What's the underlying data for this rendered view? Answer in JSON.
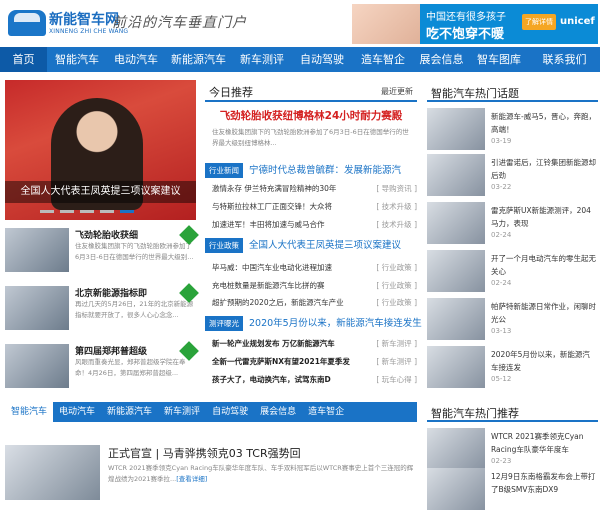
{
  "header": {
    "logo_text": "新能智车网",
    "logo_sub": "XINNENG ZHI CHE WANG",
    "slogan": "前沿的汽车垂直门户",
    "ad": {
      "line1": "中国还有很多孩子",
      "line2": "吃不饱穿不暖",
      "button": "了解详情",
      "brand": "unicef"
    }
  },
  "nav": {
    "items": [
      "首页",
      "智能汽车",
      "电动汽车",
      "新能源汽车",
      "新车测评",
      "自动驾驶",
      "造车智企",
      "展会信息",
      "智车图库",
      "联系我们"
    ]
  },
  "slider": {
    "caption": "全国人大代表王凤英提三项议案建议",
    "dots": 5,
    "active_dot": 5
  },
  "left_list": [
    {
      "title": "飞劲轮胎收获细",
      "desc": "住友橡胶集团旗下的飞劲轮胎欧洲参加了6月3日-6日在德国举行的世界最大级别..."
    },
    {
      "title": "北京新能源指标即",
      "desc": "再过几天的5月26日，21年的北京新能源指标就要开放了，很多人心心念念..."
    },
    {
      "title": "第四届郑邦普超级",
      "desc": "风眼而重奏光显，郑邦普超级学院在奉命！4月26日，第四届郑邦普超级..."
    }
  ],
  "middle": {
    "head_title": "今日推荐",
    "head_right": "最近更新",
    "headline": "飞劲轮胎收获纽博格林24小时耐力赛殿",
    "headline_desc": "住友橡胶集团旗下的飞劲轮胎欧洲参加了6月3日-6日在德国举行的世界最大级别纽博格林...",
    "sections": [
      {
        "label": "行业新闻",
        "title": "宁德时代总裁曾毓群：发展新能源汽",
        "rows": [
          {
            "text": "激情永存 伊兰特充满冒险精神的30年",
            "cat": "[ 导购资讯 ]"
          },
          {
            "text": "与特斯拉拉林工厂正面交锋！大众将",
            "cat": "[ 技术升级 ]"
          },
          {
            "text": "加速进军！丰田将加速与威马合作",
            "cat": "[ 技术升级 ]"
          }
        ]
      },
      {
        "label": "行业政策",
        "title": "全国人大代表王凤英提三项议案建议",
        "rows": [
          {
            "text": "毕马威：中国汽车业电动化进程加速",
            "cat": "[ 行业政策 ]"
          },
          {
            "text": "充电桩数量是新能源汽车比拼的赛",
            "cat": "[ 行业政策 ]"
          },
          {
            "text": "超扩预期的2020之后，新能源汽车产业",
            "cat": "[ 行业政策 ]"
          }
        ]
      },
      {
        "label": "测评曝光",
        "title": "2020年5月份以来，新能源汽车接连发生",
        "rows": [
          {
            "text": "新一轮产业规划发布 万亿新能源汽车",
            "cat": "[ 新车测评 ]"
          },
          {
            "text": "全新一代雷克萨斯NX有望2021年夏季发",
            "cat": "[ 新车测评 ]"
          },
          {
            "text": "孩子大了，电动换汽车，试驾东南D",
            "cat": "[ 玩车心得 ]"
          }
        ]
      }
    ]
  },
  "right_top": {
    "title": "智能汽车热门话题",
    "items": [
      {
        "text": "新能源车-威马5，晋心，奔跑，高端！",
        "date": "03-19"
      },
      {
        "text": "引进雷诺后，江铃集团新能源却后劲",
        "date": "03-22"
      },
      {
        "text": "雷克萨斯UX新能源测评，204马力，表现",
        "date": "02-24"
      },
      {
        "text": "开了一个月电动汽车的零生起无关心",
        "date": "02-24"
      },
      {
        "text": "帕萨特新能源日常作业，闲聊时光公",
        "date": "03-13"
      },
      {
        "text": "2020年5月份以来，新能源汽车接连发",
        "date": "05-12"
      }
    ]
  },
  "bottom_nav": {
    "items": [
      "智能汽车",
      "电动汽车",
      "新能源汽车",
      "新车测评",
      "自动驾驶",
      "展会信息",
      "造车智企"
    ]
  },
  "bottom_item": {
    "title": "正式官宣 | 马青骅携领克03 TCR强势回",
    "desc": "WTCR 2021赛季领克Cyan Racing车队豪华年度车队、车手双料冠军后以WTCR赛事史上首个三连冠的辉煌战绩为2021赛季拉...",
    "more": "[查看详细]"
  },
  "right_bottom": {
    "title": "智能汽车热门推荐",
    "items": [
      {
        "text": "WTCR 2021赛季领克Cyan Racing车队豪华年度车",
        "date": "02-23"
      },
      {
        "text": "12月9日东南格霸发布会上带打了B级SMV东南DX9",
        "date": ""
      }
    ]
  }
}
